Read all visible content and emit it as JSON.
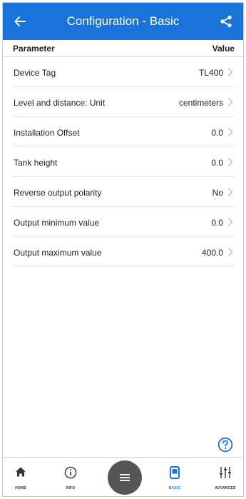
{
  "header": {
    "title": "Configuration - Basic"
  },
  "columns": {
    "parameter": "Parameter",
    "value": "Value"
  },
  "rows": [
    {
      "label": "Device Tag",
      "value": "TL400"
    },
    {
      "label": "Level and distance: Unit",
      "value": "centimeters"
    },
    {
      "label": "Installation Offset",
      "value": "0.0"
    },
    {
      "label": "Tank height",
      "value": "0.0"
    },
    {
      "label": "Reverse output polarity",
      "value": "No"
    },
    {
      "label": "Output minimum value",
      "value": "0.0"
    },
    {
      "label": "Output maximum value",
      "value": "400.0"
    }
  ],
  "nav": {
    "home": "HOME",
    "info": "INFO",
    "basic": "BASIC",
    "advanced": "ADVANCED"
  },
  "colors": {
    "primary": "#1a73d9",
    "fab": "#555555"
  }
}
